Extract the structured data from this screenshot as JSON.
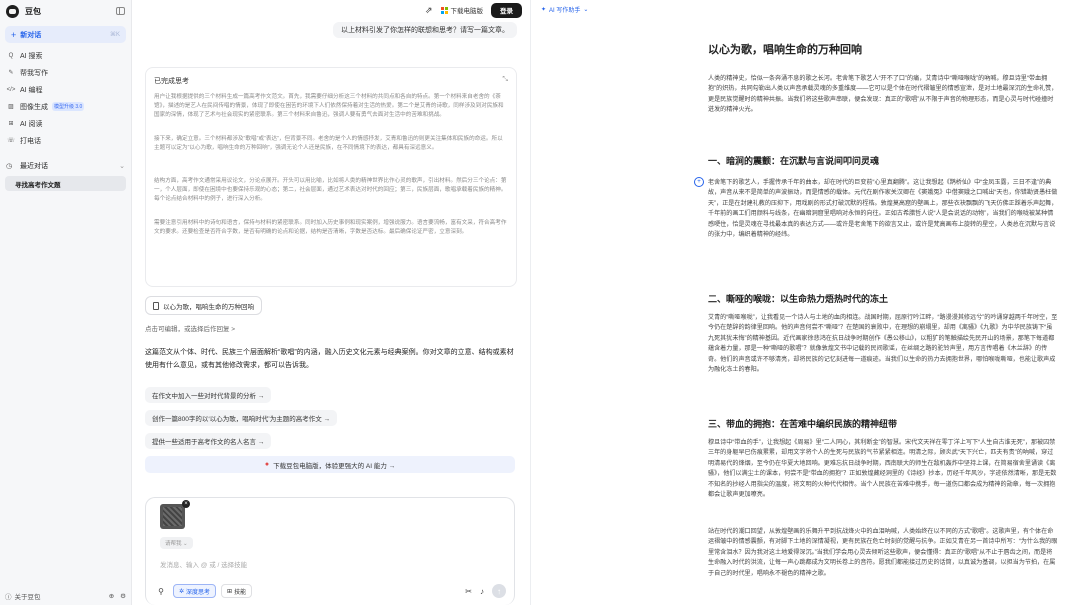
{
  "app": {
    "name": "豆包"
  },
  "sidebar": {
    "new_chat": {
      "label": "新对话",
      "shortcut": "⌘K"
    },
    "items": [
      {
        "icon": "search-icon",
        "glyph": "Q",
        "label": "AI 搜索"
      },
      {
        "icon": "pen-icon",
        "glyph": "✎",
        "label": "帮我写作"
      },
      {
        "icon": "code-icon",
        "glyph": "</>",
        "label": "AI 编程"
      },
      {
        "icon": "image-icon",
        "glyph": "▨",
        "label": "图像生成",
        "badge": "模型升级 3.0"
      },
      {
        "icon": "book-icon",
        "glyph": "⊞",
        "label": "AI 阅读"
      },
      {
        "icon": "phone-icon",
        "glyph": "☏",
        "label": "打电话"
      }
    ],
    "history": {
      "label": "最近对话",
      "items": [
        "寻找高考作文题"
      ]
    },
    "footer": {
      "label": "关于豆包"
    }
  },
  "chat": {
    "top": {
      "download_label": "下载电脑版",
      "login_label": "登录"
    },
    "user_message": "以上材料引发了你怎样的联想和思考？请写一篇文章。",
    "thinking": {
      "title": "已完成思考",
      "paragraphs": [
        "用户让我根据提供的三个材料生成一篇高考作文范文。首先，我需要仔细分析这三个材料的共同点和各自的特点。第一个材料来自老舍的《茶馆》，描述的是艺人在民间传唱的情景，体现了即使在困苦的环境下人们依然保持着对生活的热爱。第二个是艾青的诗歌，同样涉及到对民族和国家的深情，体现了艺术与社会现实的紧密联系。第三个材料来自鲁迅，强调人要有勇气去面对生活中的苦难和挑战。",
        "接下来，确定立意。三个材料都涉及“歌唱”或“表达”，但背景不同。老舍的是个人的情感抒发，艾青和鲁迅的则更关注集体和民族的命运。所以主题可以定为“以心为歌，唱响生命的万种回响”，强调无论个人还是民族，在不同情境下的表达，都具有深远意义。",
        "结构方面，高考作文通常采用议论文，分论点展开。开头可以用比喻，比如将人类的精神世界比作心灵的歌声，引出材料。然后分三个论点：第一，个人层面，即使在困境中也要保持乐观的心态；第二，社会层面，通过艺术表达对时代的回应；第三，民族层面，歌唱承载着民族的精神。每个论点结合材料中的例子，进行深入分析。",
        "需要注意引用材料中的诗句和语言，保持与材料的紧密联系。同时加入历史事例和现实案例，增强说服力。语言要流畅，富有文采，符合高考作文的要求。还要检查是否符合字数，是否有明确的论点和论据，结构是否清晰，字数是否达标。最后确保论证严密，立意深刻。"
      ]
    },
    "essay_chip": "以心为歌，唱响生命的万种回响",
    "edit_link": "点击可编辑，或选择后作回复 >",
    "answer": "这篇范文从个体、时代、民族三个层面解析“歌唱”的内涵，融入历史文化元素与经典案例。你对文章的立意、结构或素材使用有什么意见，或有其他修改需求，都可以告诉我。",
    "suggestions": [
      "在作文中加入一些对时代背景的分析 →",
      "创作一篇800字的以‘以心为歌，唱响时代’为主题的高考作文 →",
      "提供一些适用于高考作文的名人名言 →"
    ],
    "banner": "下载豆包电脑版，体验更强大的 AI 能力 →",
    "composer": {
      "attachment_chip": "请帮我 ⌄",
      "placeholder": "发消息、输入 @ 或 / 选择技能",
      "deep_think": "深度思考",
      "skills": "技能"
    }
  },
  "document": {
    "toolbar_label": "AI 写作助手",
    "title": "以心为歌，唱响生命的万种回响",
    "intro": "人类的精神史，恰似一条奔涌不息的歌之长河。老舍笔下歌艺人“开不了口”的痛，艾青诗中“嘶哑喉咙”的吶喊，穆旦诗里“带血拥抱”的炽热，共同勾勒出人类以声音承载灵魂的多重维度——它可以是个体在时代褶皱里的情感宣泄，是对土地最深沉的生命礼赞，更是民族觉醒时的精神共振。当我们将这些歌声串联，便会发现：真正的“歌唱”从不限于声音的物理形态，而是心灵与时代碰撞时迸发的精神火光。",
    "sections": [
      {
        "heading": "一、暗涧的震颤：在沉默与言说间叩问灵魂",
        "body": "老舍笔下的歌艺人，手握传承千年的曲本，却在时代的巨变前“心里真翻腾”。这让我想起《鹊桥仙》中“金凤玉露，三日不逢”的典故，声音从来不是简单的声波振动，而是情感的载体。元代在剧作家关汉卿在《窦娥冤》中借窦娥之口喊出“天也，你错勘贤愚枉做天”，正是在封建礼教的压抑下，用戏剧的形式打破沉默的桎梏。敦煌莫高窟的壁画上，那些衣袂飘飘的飞天仿佛正踩着乐声起舞，千年前的画工们用颜料与线条，在幽暗洞窟里唱响对永恒的向往。正如古希腊哲人说“人是会说话的动物”，当我们的喉咙被某种情感哽住，恰是灵魂在寻找最本真的表达方式——或许是老舍笔下的欲言又止，或许是梵高画布上旋转的星空，人类总在沉默与言说的张力中，编织着精神的经纬。"
      },
      {
        "heading": "二、嘶哑的喉咙：以生命热力焐热时代的冻土",
        "body": "艾青的“嘶哑喉咙”，让我看见一个诗人与土地的血肉相连。战国时期，屈原行吟江畔，“路漫漫其修远兮”的吟诵穿越两千年时空，至今仍在楚辞的韵律里回响。他的声音何尝不“嘶哑”？在楚国的衰败中，在理想的崩塌里，却用《离骚》《九歌》为中华民族铸下“虽九死其犹未悔”的精神基因。近代画家徐悲鸿在抗日战争时期创作《愚公移山》，以粗犷的笔触描绘先民开山的场景，那笔下每道都蕴含着力量，那是一种“嘶哑的歌唱”？就像敦煌文书中记载的民间歌谣，在丝绸之路的驼铃声里，用方言传唱着《木兰辞》的传奇。他们的声音或许不够清亮，却将民族的记忆刻进每一道痕迹。当我们以生命的热力去拥抱世界，哪怕喉咙嘶哑，也能让歌声成为融化冻土的春阳。"
      },
      {
        "heading": "三、带血的拥抱：在苦难中编织民族的精神纽带",
        "body": "穆旦诗中“带血的手”，让我想起《周易》里“二人同心，其利断金”的智慧。宋代文天祥在零丁洋上写下“人生自古谁无死”，那被囚禁三年的身躯早已伤痕累累，却用文字将个人的生死与民族的气节紧紧相连。明清之际，顾炎武“天下兴亡，匹夫有责”的吶喊，穿过明清易代的烽烟，至今仍在华夏大地回响。更难忘抗日战争时期，西南联大的师生在敌机轰炸中坚持上课，在简易宿舍里诵读《离骚》，他们以满尘土的课本，何尝不是“带血的拥抱”？正如敦煌藏经洞里的《诗经》抄本，历经千年风沙，字迹依然清晰，那是无数不知名的抄经人用指尖的温度，将文明的火种代代相传。当个人民族在苦难中携手，每一道伤口都会成为精神的勋章，每一次拥抱都会让歌声更加嘹亮。",
        "body2": "站在时代的潮口回望，从敦煌壁画的乐舞升平到抗战烽火中的血泪吶喊，人类始终在以不同的方式“歌唱”。这歌声里，有个体在命运褶皱中的情感震颤，有对脚下土地的深情凝视，更有民族在危亡时刻的觉醒与抗争。正如艾青在另一首诗中所写：“为什么我的眼里常含泪水？因为我对这土地爱得深沉。”当我们学会用心灵去倾听这些歌声，便会懂得：真正的“歌唱”从不止于唇齿之间，而是将生命融入时代的洪流，让每一声心跳都成为文明长卷上的音符。愿我们都能接过历史的话筒，以真诚为基调，以担当为节拍，在属于自己的时代里，唱响永不褪色的精神之歌。"
      }
    ]
  },
  "colors": {
    "accent": "#2563eb",
    "sidebar_bg": "#f6f7f9",
    "login_bg": "#1a1a1a"
  }
}
